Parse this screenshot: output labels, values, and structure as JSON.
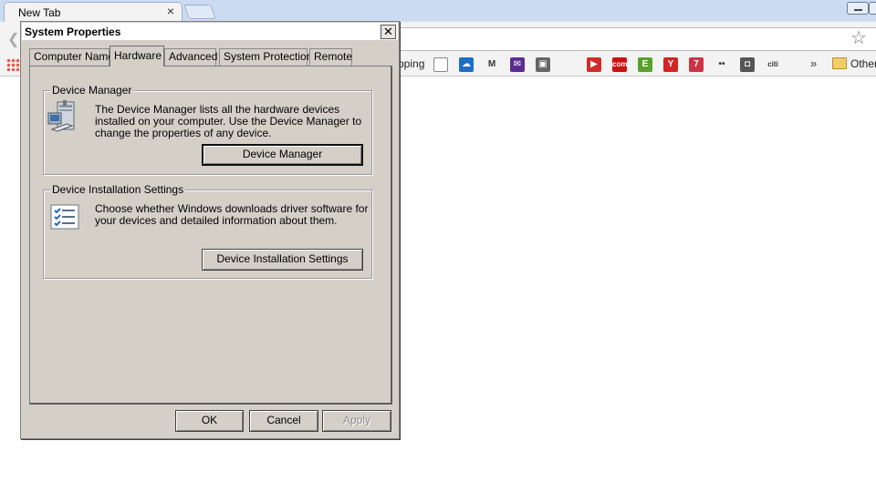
{
  "browser": {
    "tab_title": "New Tab",
    "tab_close": "×",
    "star_icon": "☆",
    "bookmarks": {
      "partial_label": "pping",
      "more_label": "»",
      "other_label": "Other",
      "icons": [
        {
          "name": "doc-bookmark-icon",
          "glyph": "",
          "color": "#ffffff"
        },
        {
          "name": "cloud-bookmark-icon",
          "glyph": "☁",
          "color": "#1e6fc4"
        },
        {
          "name": "gmail-bookmark-icon",
          "glyph": "M",
          "color": "#ffffff"
        },
        {
          "name": "yahoo-mail-bookmark-icon",
          "glyph": "✉",
          "color": "#5b2d91"
        },
        {
          "name": "contacts-bookmark-icon",
          "glyph": "▣",
          "color": "#666666"
        },
        {
          "name": "apple-bookmark-icon",
          "glyph": "",
          "color": "#ffffff"
        },
        {
          "name": "youtube-bookmark-icon",
          "glyph": "▶",
          "color": "#d32a2a"
        },
        {
          "name": "cnn-bookmark-icon",
          "glyph": "com",
          "color": "#cc1111"
        },
        {
          "name": "evernote-bookmark-icon",
          "glyph": "E",
          "color": "#5aa02c"
        },
        {
          "name": "yelp-bookmark-icon",
          "glyph": "Y",
          "color": "#d32323"
        },
        {
          "name": "news-bookmark-icon",
          "glyph": "7",
          "color": "#cc3344"
        },
        {
          "name": "flickr-bookmark-icon",
          "glyph": "••",
          "color": "#ffffff"
        },
        {
          "name": "camera-bookmark-icon",
          "glyph": "◘",
          "color": "#555555"
        },
        {
          "name": "citi-bookmark-icon",
          "glyph": "citi",
          "color": "#ffffff"
        }
      ]
    }
  },
  "dialog": {
    "title": "System Properties",
    "close_glyph": "✕",
    "tabs": [
      "Computer Name",
      "Hardware",
      "Advanced",
      "System Protection",
      "Remote"
    ],
    "active_tab": "Hardware",
    "device_manager": {
      "label": "Device Manager",
      "description": "The Device Manager lists all the hardware devices installed on your computer. Use the Device Manager to change the properties of any device.",
      "button": "Device Manager"
    },
    "device_installation": {
      "label": "Device Installation Settings",
      "description": "Choose whether Windows downloads driver software for your devices and detailed information about them.",
      "button": "Device Installation Settings"
    },
    "buttons": {
      "ok": "OK",
      "cancel": "Cancel",
      "apply": "Apply"
    }
  }
}
